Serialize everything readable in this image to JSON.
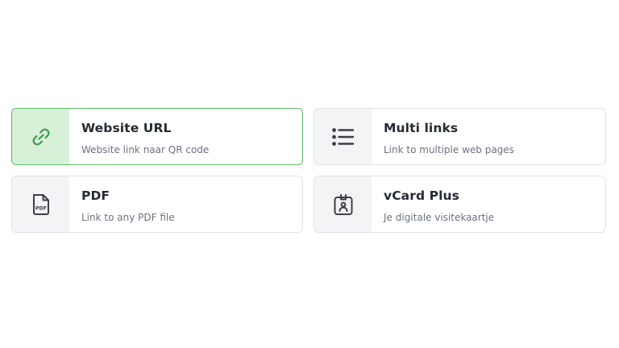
{
  "options": [
    {
      "title": "Website URL",
      "subtitle": "Website link naar QR code",
      "icon": "link-icon",
      "selected": true
    },
    {
      "title": "Multi links",
      "subtitle": "Link to multiple web pages",
      "icon": "list-icon",
      "selected": false
    },
    {
      "title": "PDF",
      "subtitle": "Link to any PDF file",
      "icon": "pdf-file-icon",
      "selected": false
    },
    {
      "title": "vCard Plus",
      "subtitle": "Je digitale visitekaartje",
      "icon": "id-badge-icon",
      "selected": false
    }
  ],
  "colors": {
    "selected_border": "#5cb865",
    "selected_icon_bg": "#d7f0d8",
    "selected_icon": "#3f9a49",
    "icon": "#3a3f47",
    "icon_bg": "#f3f4f6"
  }
}
